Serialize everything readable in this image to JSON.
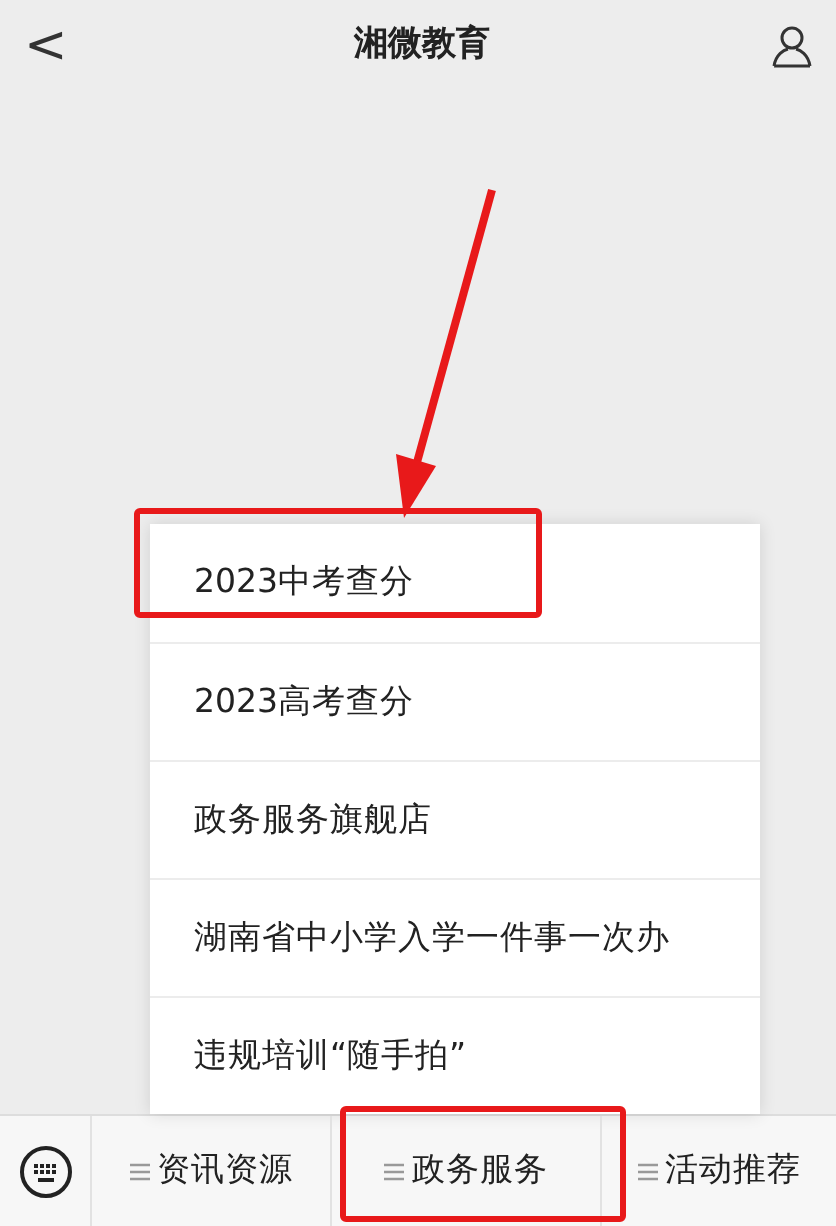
{
  "header": {
    "back": "<",
    "title": "湘微教育"
  },
  "popup_menu": [
    {
      "label": "2023中考查分",
      "highlighted": true
    },
    {
      "label": "2023高考查分",
      "highlighted": false
    },
    {
      "label": "政务服务旗舰店",
      "highlighted": false
    },
    {
      "label": "湖南省中小学入学一件事一次办",
      "highlighted": false
    },
    {
      "label": "违规培训“随手拍”",
      "highlighted": false
    }
  ],
  "bottom_menu": [
    {
      "label": "资讯资源",
      "highlighted": false
    },
    {
      "label": "政务服务",
      "highlighted": true
    },
    {
      "label": "活动推荐",
      "highlighted": false
    }
  ]
}
